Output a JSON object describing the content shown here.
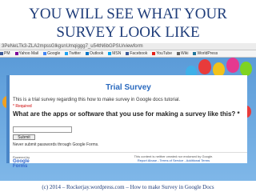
{
  "slide": {
    "title_line1": "YOU WILL SEE WHAT YOUR",
    "title_line2": "SURVEY LOOK LIKE",
    "caption": "(c) 2014 – Rockerjay.wordpress.com – How to make Survey in Google Docs"
  },
  "browser": {
    "url": "3PeNeLTk3-ZLA2mpssGlkgsnUmqiggg7_u54tN6bGPSU/viewform",
    "bookmarks": [
      {
        "label": "PM",
        "icon": "bookmark-icon",
        "color": "#3b5998"
      },
      {
        "label": "Yahoo Mail",
        "icon": "yahoo-icon",
        "color": "#7b0099"
      },
      {
        "label": "Google",
        "icon": "google-icon",
        "color": "#4285f4"
      },
      {
        "label": "Twitter",
        "icon": "twitter-icon",
        "color": "#1da1f2"
      },
      {
        "label": "Outlook",
        "icon": "outlook-icon",
        "color": "#0072c6"
      },
      {
        "label": "MSN",
        "icon": "msn-icon",
        "color": "#00a4ef"
      },
      {
        "label": "Facebook",
        "icon": "facebook-icon",
        "color": "#3b5998"
      },
      {
        "label": "YouTube",
        "icon": "youtube-icon",
        "color": "#e62117"
      },
      {
        "label": "Wiki",
        "icon": "wiki-icon",
        "color": "#666666"
      },
      {
        "label": "WorldPress",
        "icon": "wordpress-icon",
        "color": "#21759b"
      }
    ]
  },
  "form": {
    "title": "Trial Survey",
    "description": "This is a trial survey regarding this how to make survey in Google docs tutorial.",
    "required_note": "* Required",
    "question": "What are the apps or software that you use for making a survey like this? *",
    "answer_value": "",
    "submit_label": "Submit",
    "password_note": "Never submit passwords through Google Forms.",
    "powered_by": "Powered by",
    "powered_brand": "Google Forms",
    "footer_line1": "This content is neither created nor endorsed by Google.",
    "footer_links": "Report Abuse - Terms of Service - Additional Terms"
  },
  "colors": {
    "accent": "#2a6abf",
    "slide_title": "#1f3d7a",
    "background": "#6aa9e0"
  }
}
